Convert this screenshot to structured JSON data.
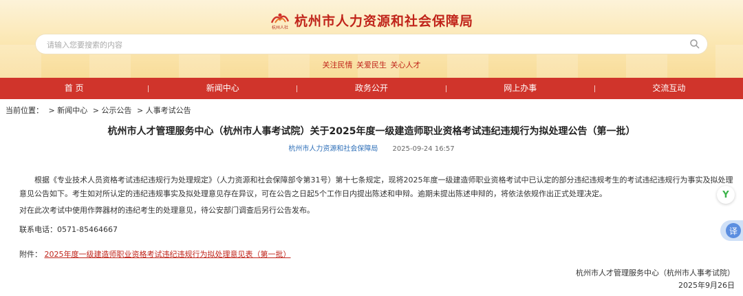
{
  "header": {
    "logo_text": "杭州人社",
    "site_title": "杭州市人力资源和社会保障局",
    "search_placeholder": "请输入您要搜索的内容",
    "slogan": "关注民情 关爱民生 关心人才"
  },
  "nav": {
    "items": [
      {
        "label": "首 页"
      },
      {
        "label": "新闻中心"
      },
      {
        "label": "政务公开"
      },
      {
        "label": "网上办事"
      },
      {
        "label": "交流互动"
      }
    ]
  },
  "breadcrumb": {
    "prefix": "当前位置：",
    "items": [
      {
        "label": "> 新闻中心"
      },
      {
        "label": "> 公示公告"
      },
      {
        "label": "> 人事考试公告"
      }
    ]
  },
  "article": {
    "title": "杭州市人才管理服务中心（杭州市人事考试院）关于2025年度一级建造师职业资格考试违纪违规行为拟处理公告（第一批）",
    "source": "杭州市人力资源和社会保障局",
    "date": "2025-09-24 16:57",
    "paragraph1": "根据《专业技术人员资格考试违纪违规行为处理规定》（人力资源和社会保障部令第31号）第十七条规定，现将2025年度一级建造师职业资格考试中已认定的部分违纪违规考生的考试违纪违规行为事实及拟处理意见公告如下。考生如对所认定的违纪违规事实及拟处理意见存在异议，可在公告之日起5个工作日内提出陈述和申辩。逾期未提出陈述申辩的，将依法依规作出正式处理决定。",
    "paragraph2": "对在此次考试中使用作弊器材的违纪考生的处理意见，待公安部门调查后另行公告发布。",
    "phone": "联系电话：0571-85464667",
    "attachment_label": "附件：",
    "attachment_link": "2025年度一级建造师职业资格考试违纪违规行为拟处理意见表（第一批）",
    "signer": "杭州市人才管理服务中心（杭州市人事考试院）",
    "sign_date": "2025年9月26日"
  },
  "floating": {
    "v_label": "Y",
    "translate_label": "译"
  },
  "colors": {
    "brand_red": "#d0342b",
    "title_red": "#c0241a",
    "link_blue": "#2e6fb8"
  }
}
